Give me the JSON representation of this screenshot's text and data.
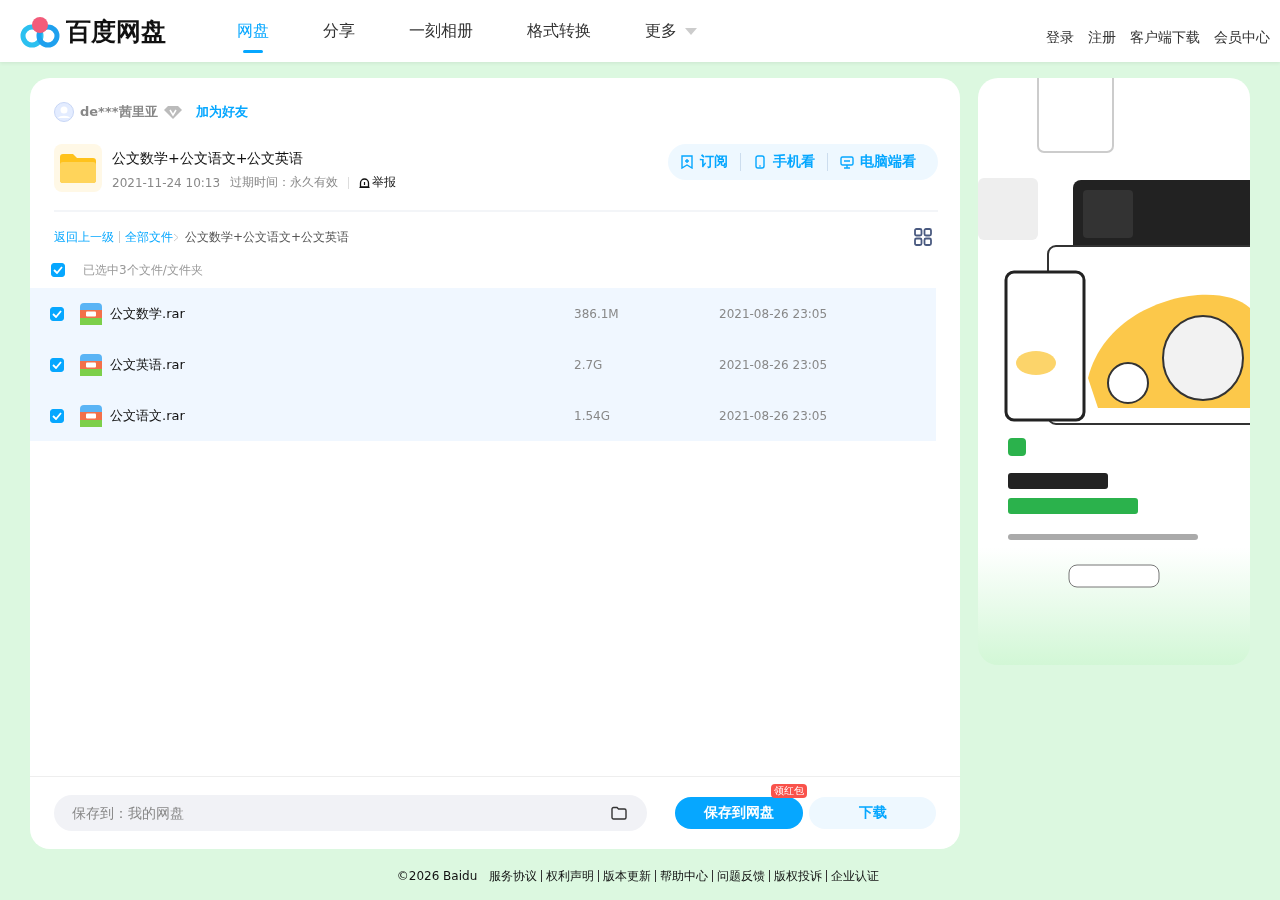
{
  "header": {
    "logo_text": "百度网盘",
    "nav": [
      {
        "label": "网盘",
        "selected": true,
        "dropdown": false
      },
      {
        "label": "分享",
        "selected": false,
        "dropdown": false
      },
      {
        "label": "一刻相册",
        "selected": false,
        "dropdown": false
      },
      {
        "label": "格式转换",
        "selected": false,
        "dropdown": false
      },
      {
        "label": "更多",
        "selected": false,
        "dropdown": true
      }
    ],
    "links": [
      "登录",
      "注册",
      "客户端下载",
      "会员中心"
    ]
  },
  "share": {
    "user": "de***茜里亚",
    "add_friend": "加为好友",
    "title": "公文数学+公文语文+公文英语",
    "date": "2021-11-24 10:13",
    "expiry": "过期时间：永久有效",
    "report": "举报",
    "actions": [
      {
        "kind": "subscribe",
        "label": "订阅"
      },
      {
        "kind": "phone",
        "label": "手机看"
      },
      {
        "kind": "desktop",
        "label": "电脑端看"
      }
    ]
  },
  "breadcrumb": {
    "back": "返回上一级",
    "all": "全部文件",
    "current": "公文数学+公文语文+公文英语"
  },
  "selection": {
    "checked": true,
    "text": "已选中3个文件/文件夹"
  },
  "files": [
    {
      "name": "公文数学.rar",
      "size": "386.1M",
      "date": "2021-08-26 23:05",
      "checked": true
    },
    {
      "name": "公文英语.rar",
      "size": "2.7G",
      "date": "2021-08-26 23:05",
      "checked": true
    },
    {
      "name": "公文语文.rar",
      "size": "1.54G",
      "date": "2021-08-26 23:05",
      "checked": true
    }
  ],
  "save_bar": {
    "placeholder": "保存到：我的网盘",
    "save": "保存到网盘",
    "badge": "领红包",
    "download": "下载"
  },
  "footer": {
    "copyright": "©2026 Baidu",
    "links": [
      "服务协议",
      "权利声明",
      "版本更新",
      "帮助中心",
      "问题反馈",
      "版权投诉",
      "企业认证"
    ]
  }
}
